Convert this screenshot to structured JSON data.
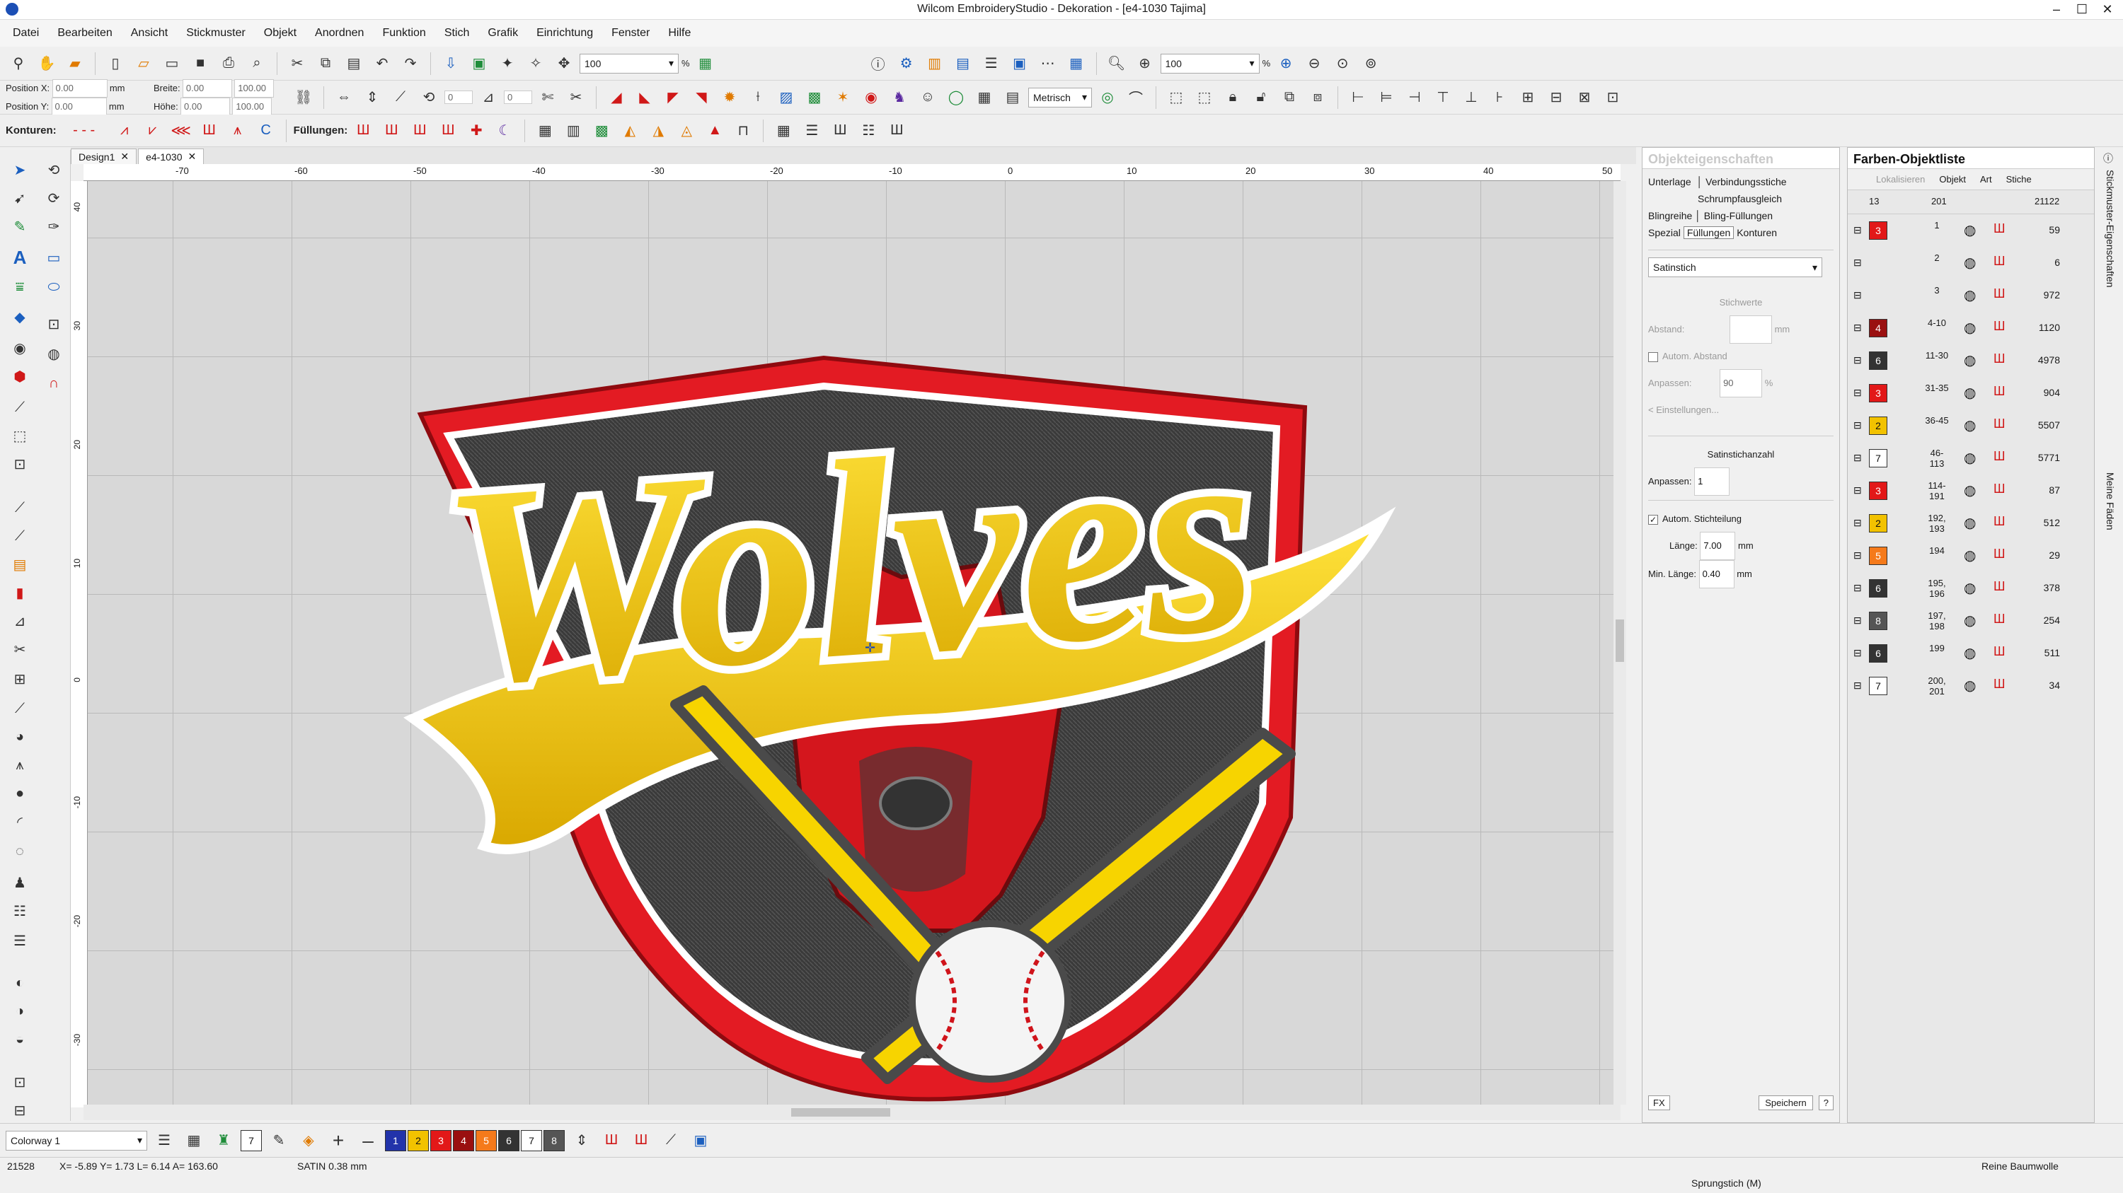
{
  "window": {
    "title": "Wilcom EmbroideryStudio - Dekoration - [e4-1030       Tajima]"
  },
  "menu": [
    "Datei",
    "Bearbeiten",
    "Ansicht",
    "Stickmuster",
    "Objekt",
    "Anordnen",
    "Funktion",
    "Stich",
    "Grafik",
    "Einrichtung",
    "Fenster",
    "Hilfe"
  ],
  "toolbar": {
    "zoom1": "100",
    "zoom1_unit": "%",
    "zoom2": "100",
    "zoom2_unit": "%"
  },
  "toolbar2": {
    "pos_x_label": "Position X:",
    "pos_x": "0.00",
    "pos_y_label": "Position Y:",
    "pos_y": "0.00",
    "unit": "mm",
    "width_label": "Breite:",
    "width": "0.00",
    "height_label": "Höhe:",
    "height": "0.00",
    "w_pct": "100.00",
    "h_pct": "100.00",
    "angle1": "0",
    "angle2": "0",
    "units": "Metrisch"
  },
  "toolbar3": {
    "konturen_label": "Konturen:",
    "fuellungen_label": "Füllungen:"
  },
  "tabs": [
    {
      "label": "Design1"
    },
    {
      "label": "e4-1030"
    }
  ],
  "ruler": {
    "h": [
      "-70",
      "-60",
      "-50",
      "-40",
      "-30",
      "-20",
      "-10",
      "0",
      "10",
      "20",
      "30",
      "40",
      "50"
    ],
    "v": [
      "40",
      "30",
      "20",
      "10",
      "0",
      "-10",
      "-20",
      "-30"
    ]
  },
  "design": {
    "text": "Wolves"
  },
  "props": {
    "title": "Objekteigenschaften",
    "tabs": {
      "unterlage": "Unterlage",
      "verbindung": "Verbindungsstiche",
      "schrumpf": "Schrumpfausgleich",
      "blingreihe": "Blingreihe",
      "blingfuell": "Bling-Füllungen",
      "spezial": "Spezial",
      "fuellungen": "Füllungen",
      "konturen": "Konturen"
    },
    "stitch_type": "Satinstich",
    "stichwerte": "Stichwerte",
    "abstand_label": "Abstand:",
    "abstand_unit": "mm",
    "autom_abstand": "Autom. Abstand",
    "anpassen_label": "Anpassen:",
    "anpassen_value": "90",
    "anpassen_unit": "%",
    "einstellungen": "< Einstellungen...",
    "satin_count": "Satinstichanzahl",
    "anpassen2_value": "1",
    "autom_stichteilung": "Autom. Stichteilung",
    "laenge_label": "Länge:",
    "laenge_value": "7.00",
    "mm": "mm",
    "min_laenge_label": "Min. Länge:",
    "min_laenge_value": "0.40",
    "fx": "FX",
    "speichern": "Speichern",
    "help": "?"
  },
  "objlist": {
    "title": "Farben-Objektliste",
    "lokalisieren": "Lokalisieren",
    "col_objekt": "Objekt",
    "col_art": "Art",
    "col_stiche": "Stiche",
    "head_left": "13",
    "head_mid": "201",
    "head_right": "21122",
    "rows": [
      {
        "color": "3",
        "obj": "1",
        "stitches": "59"
      },
      {
        "color": "",
        "obj": "2",
        "stitches": "6"
      },
      {
        "color": "",
        "obj": "3",
        "stitches": "972"
      },
      {
        "color": "4",
        "obj": "4-10",
        "stitches": "1120"
      },
      {
        "color": "6",
        "obj": "11-30",
        "stitches": "4978"
      },
      {
        "color": "3",
        "obj": "31-35",
        "stitches": "904"
      },
      {
        "color": "2",
        "obj": "36-45",
        "stitches": "5507"
      },
      {
        "color": "7",
        "obj": "46-\n113",
        "stitches": "5771"
      },
      {
        "color": "3",
        "obj": "114-\n191",
        "stitches": "87"
      },
      {
        "color": "2",
        "obj": "192,\n193",
        "stitches": "512"
      },
      {
        "color": "5",
        "obj": "194",
        "stitches": "29"
      },
      {
        "color": "6",
        "obj": "195,\n196",
        "stitches": "378"
      },
      {
        "color": "8",
        "obj": "197,\n198",
        "stitches": "254"
      },
      {
        "color": "6",
        "obj": "199",
        "stitches": "511"
      },
      {
        "color": "7",
        "obj": "200,\n201",
        "stitches": "34"
      }
    ]
  },
  "sidetabs": {
    "a": "Stickmuster-Eigenschaften",
    "b": "Meine Fäden"
  },
  "colorway": {
    "label": "Colorway 1",
    "current": "7",
    "palette": [
      "1",
      "2",
      "3",
      "4",
      "5",
      "6",
      "7",
      "8"
    ]
  },
  "palette_colors": {
    "1": "#2233aa",
    "2": "#f2c200",
    "3": "#e21818",
    "4": "#9a1010",
    "5": "#f57a1b",
    "6": "#333333",
    "7": "#ffffff",
    "8": "#555555"
  },
  "status": {
    "stitches": "21528",
    "coords": "X=  -5.89 Y=   1.73 L=    6.14 A= 163.60",
    "mode": "SATIN  0.38 mm",
    "thread": "Reine Baumwolle",
    "jump": "Sprungstich (M)"
  }
}
